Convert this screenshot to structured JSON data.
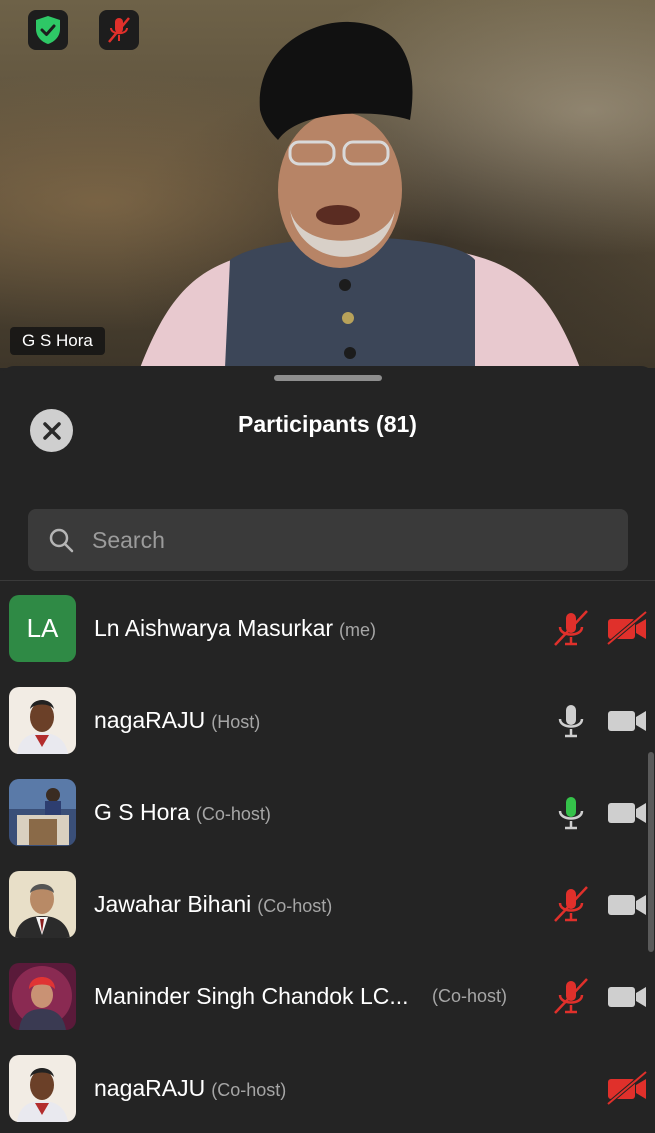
{
  "video": {
    "speaker_name": "G S Hora",
    "badges": [
      {
        "icon": "shield-check-icon",
        "color": "#2ec866"
      },
      {
        "icon": "mic-muted-icon",
        "color": "#e0302b"
      }
    ]
  },
  "panel": {
    "title": "Participants (81)",
    "close_icon": "close-icon",
    "search": {
      "placeholder": "Search",
      "value": ""
    }
  },
  "participants": [
    {
      "initials": "LA",
      "name": "Ln Aishwarya Masurkar",
      "role": "(me)",
      "mic": "muted",
      "cam": "off"
    },
    {
      "initials": "",
      "name": "nagaRAJU",
      "role": "(Host)",
      "mic": "unmuted",
      "cam": "on"
    },
    {
      "initials": "",
      "name": "G S Hora",
      "role": "(Co-host)",
      "mic": "speaking",
      "cam": "on"
    },
    {
      "initials": "",
      "name": "Jawahar Bihani",
      "role": "(Co-host)",
      "mic": "muted",
      "cam": "on"
    },
    {
      "initials": "",
      "name": "Maninder Singh Chandok LC...",
      "role": "(Co-host)",
      "mic": "muted",
      "cam": "on"
    },
    {
      "initials": "",
      "name": "nagaRAJU",
      "role": "(Co-host)",
      "mic": "none",
      "cam": "off"
    }
  ],
  "colors": {
    "muted": "#e0302b",
    "speaking": "#35c24a",
    "neutral": "#cfcfcf",
    "accent": "#2f8a45"
  }
}
